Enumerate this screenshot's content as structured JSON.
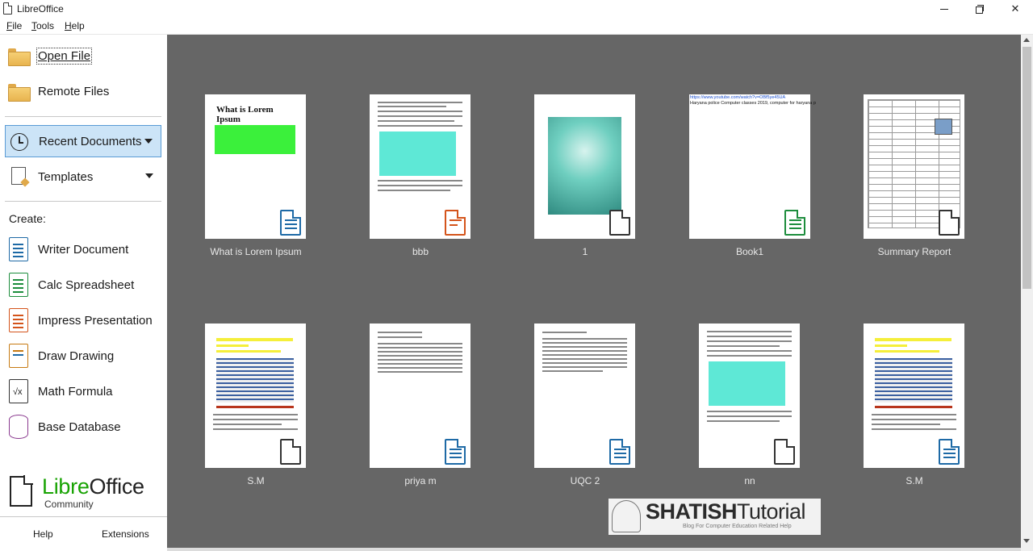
{
  "window": {
    "title": "LibreOffice"
  },
  "menu": [
    "File",
    "Tools",
    "Help"
  ],
  "sidebar": {
    "open_file": "Open File",
    "remote_files": "Remote Files",
    "recent_documents": "Recent Documents",
    "templates": "Templates",
    "create_label": "Create:",
    "create_items": [
      "Writer Document",
      "Calc Spreadsheet",
      "Impress Presentation",
      "Draw Drawing",
      "Math Formula",
      "Base Database"
    ],
    "logo": {
      "libre": "Libre",
      "office": "Office",
      "edition": "Community"
    },
    "footer": {
      "help": "Help",
      "extensions": "Extensions"
    }
  },
  "recent_files": [
    {
      "name": "What is Lorem Ipsum",
      "type": "writer"
    },
    {
      "name": "bbb",
      "type": "impress"
    },
    {
      "name": "1",
      "type": "generic"
    },
    {
      "name": "Book1",
      "type": "calc"
    },
    {
      "name": "Summary Report",
      "type": "generic"
    },
    {
      "name": "S.M",
      "type": "generic"
    },
    {
      "name": "priya m",
      "type": "writer"
    },
    {
      "name": "UQC 2",
      "type": "writer"
    },
    {
      "name": "nn",
      "type": "generic"
    },
    {
      "name": "S.M",
      "type": "writer"
    }
  ],
  "thumb_text": {
    "lorem_title_1": "What is Lorem",
    "lorem_title_2": "Ipsum",
    "book1_url": "https://www.youtube.com/watch?v=OBf5ye45UA",
    "book1_line": "Haryana police Computer classes 2019, computer for haryana p"
  },
  "watermark": {
    "bold": "SHATISH",
    "rest": "Tutorial",
    "sub": "Blog For Computer Education Related Help"
  },
  "colors": {
    "main_bg": "#666666",
    "active_bg": "#cce4f7",
    "logo_green": "#18a303"
  }
}
